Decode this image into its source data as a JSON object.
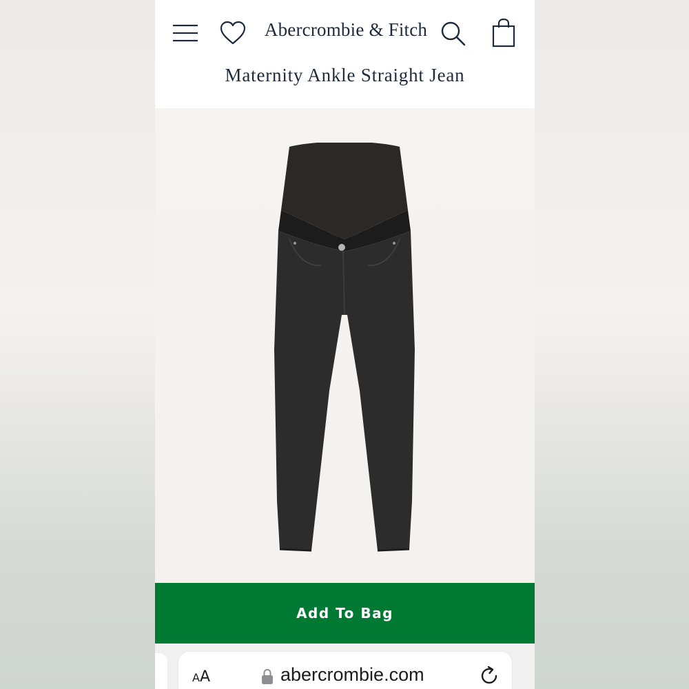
{
  "header": {
    "brand": "Abercrombie & Fitch",
    "product_title": "Maternity Ankle Straight Jean"
  },
  "icons": {
    "menu": "hamburger-menu-icon",
    "wishlist": "heart-icon",
    "search": "search-icon",
    "bag": "shopping-bag-icon"
  },
  "product": {
    "image": "black maternity straight jean with over-belly panel"
  },
  "cta": {
    "label": "Add To Bag",
    "color": "#007a33"
  },
  "browser": {
    "text_size_label_small": "A",
    "text_size_label_large": "A",
    "url": "abercrombie.com"
  }
}
